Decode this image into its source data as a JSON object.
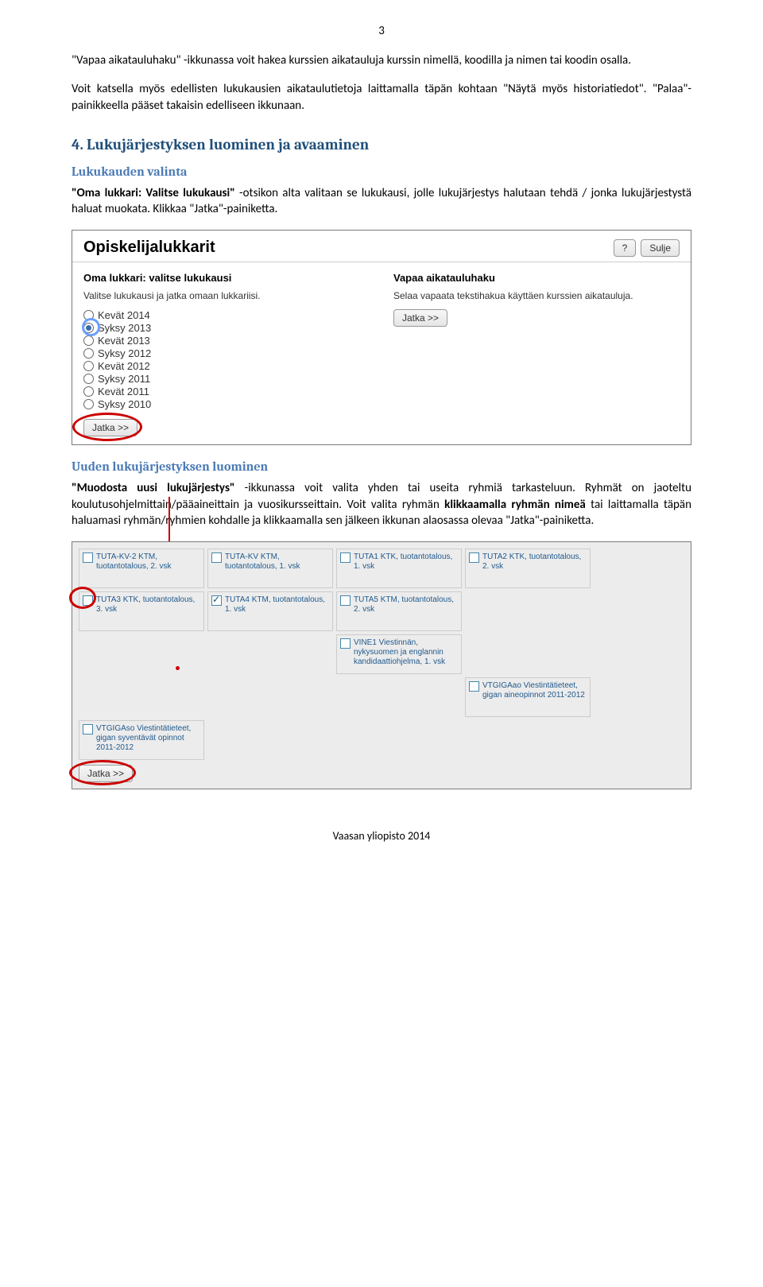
{
  "page_number": "3",
  "intro_para": "\"Vapaa aikatauluhaku\" -ikkunassa voit hakea kurssien aikatauluja kurssin nimellä, koodilla ja nimen tai koodin osalla.",
  "intro_para2": "Voit katsella myös edellisten lukukausien aikataulutietoja laittamalla täpän kohtaan \"Näytä myös historiatiedot\". \"Palaa\"-painikkeella pääset takaisin edelliseen ikkunaan.",
  "section4_title": "4. Lukujärjestyksen luominen ja avaaminen",
  "sub1_title": "Lukukauden valinta",
  "sub1_para_bold": "\"Oma lukkari: Valitse lukukausi\"",
  "sub1_para_rest": " -otsikon alta valitaan se lukukausi, jolle lukujärjestys halutaan tehdä / jonka lukujärjestystä haluat muokata. Klikkaa \"Jatka\"-painiketta.",
  "ss1": {
    "title": "Opiskelijalukkarit",
    "help_btn": "?",
    "close_btn": "Sulje",
    "col1_hdr": "Oma lukkari: valitse lukukausi",
    "col1_desc": "Valitse lukukausi ja jatka omaan lukkariisi.",
    "col2_hdr": "Vapaa aikatauluhaku",
    "col2_desc": "Selaa vapaata tekstihakua käyttäen kurssien aikatauluja.",
    "col2_btn": "Jatka >>",
    "jatka_btn": "Jatka >>",
    "radios": [
      {
        "label": "Kevät 2014",
        "selected": false
      },
      {
        "label": "Syksy 2013",
        "selected": true
      },
      {
        "label": "Kevät 2013",
        "selected": false
      },
      {
        "label": "Syksy 2012",
        "selected": false
      },
      {
        "label": "Kevät 2012",
        "selected": false
      },
      {
        "label": "Syksy 2011",
        "selected": false
      },
      {
        "label": "Kevät 2011",
        "selected": false
      },
      {
        "label": "Syksy 2010",
        "selected": false
      }
    ]
  },
  "sub2_title": "Uuden lukujärjestyksen luominen",
  "sub2_para_bold1": "\"Muodosta uusi lukujärjestys\"",
  "sub2_para_mid1": " -ikkunassa voit valita yhden tai useita ryhmiä tarkasteluun. Ryhmät on jaoteltu koulutusohjelmittain/pääaineittain ja vuosikursseittain. Voit valita ryhmän ",
  "sub2_para_bold2": "klikkaamalla ryhmän nimeä",
  "sub2_para_mid2": " tai laittamalla täpän haluamasi ryhmän/ryhmien kohdalle ja klikkaamalla sen jälkeen ikkunan alaosassa olevaa \"Jatka\"-painiketta.",
  "ss2": {
    "cells": [
      {
        "label": "TUTA-KV-2 KTM, tuotantotalous, 2. vsk",
        "checked": false
      },
      {
        "label": "TUTA-KV KTM, tuotantotalous, 1. vsk",
        "checked": false
      },
      {
        "label": "TUTA1 KTK, tuotantotalous, 1. vsk",
        "checked": false
      },
      {
        "label": "TUTA2 KTK, tuotantotalous, 2. vsk",
        "checked": false
      },
      {
        "label": "TUTA3 KTK, tuotantotalous, 3. vsk",
        "checked": false
      },
      {
        "label": "TUTA4 KTM, tuotantotalous, 1. vsk",
        "checked": true
      },
      {
        "label": "TUTA5 KTM, tuotantotalous, 2. vsk",
        "checked": false
      },
      {
        "label": "",
        "checked": false,
        "empty": true
      },
      {
        "label": "",
        "checked": false,
        "empty": true
      },
      {
        "label": "",
        "checked": false,
        "empty": true
      },
      {
        "label": "VINE1 Viestinnän, nykysuomen ja englannin kandidaattiohjelma, 1. vsk",
        "checked": false
      },
      {
        "label": "",
        "checked": false,
        "empty": true
      },
      {
        "label": "",
        "checked": false,
        "empty": true
      },
      {
        "label": "",
        "checked": false,
        "empty": true
      },
      {
        "label": "",
        "checked": false,
        "empty": true
      },
      {
        "label": "VTGIGAao Viestintätieteet, gigan aineopinnot 2011-2012",
        "checked": false
      },
      {
        "label": "VTGIGAso Viestintätieteet, gigan syventävät opinnot 2011-2012",
        "checked": false
      },
      {
        "label": "",
        "checked": false,
        "empty": true
      },
      {
        "label": "",
        "checked": false,
        "empty": true
      },
      {
        "label": "",
        "checked": false,
        "empty": true
      }
    ],
    "jatka_btn": "Jatka >>"
  },
  "footer": "Vaasan yliopisto 2014"
}
